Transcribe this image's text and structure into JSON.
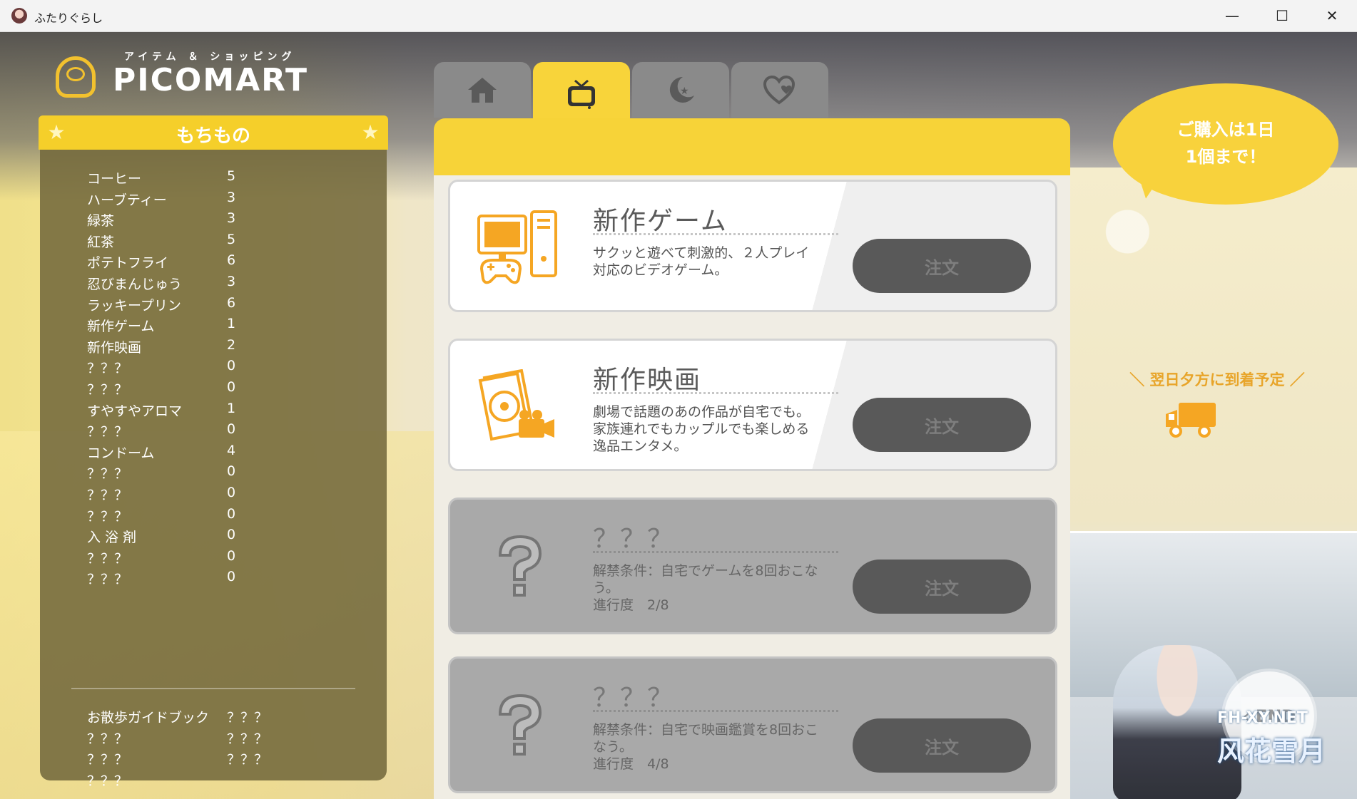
{
  "window": {
    "title": "ふたりぐらし",
    "controls": {
      "minimize": "—",
      "maximize": "☐",
      "close": "✕"
    }
  },
  "logo": {
    "subtitle": "アイテム ＆ ショッピング",
    "name": "PICOMART"
  },
  "inventory": {
    "title": "もちもの",
    "items": [
      {
        "name": "コーヒー",
        "count": "5"
      },
      {
        "name": "ハーブティー",
        "count": "3"
      },
      {
        "name": "緑茶",
        "count": "3"
      },
      {
        "name": "紅茶",
        "count": "5"
      },
      {
        "name": "ポテトフライ",
        "count": "6"
      },
      {
        "name": "忍びまんじゅう",
        "count": "3"
      },
      {
        "name": "ラッキープリン",
        "count": "6"
      },
      {
        "name": "新作ゲーム",
        "count": "1"
      },
      {
        "name": "新作映画",
        "count": "2"
      },
      {
        "name": "？？？",
        "count": "0"
      },
      {
        "name": "？？？",
        "count": "0"
      },
      {
        "name": "すやすやアロマ",
        "count": "1"
      },
      {
        "name": "？？？",
        "count": "0"
      },
      {
        "name": "コンドーム",
        "count": "4"
      },
      {
        "name": "？？？",
        "count": "0"
      },
      {
        "name": "？？？",
        "count": "0"
      },
      {
        "name": "？？？",
        "count": "0"
      },
      {
        "name": "入 浴 剤",
        "count": "0"
      },
      {
        "name": "？？？",
        "count": "0"
      },
      {
        "name": "？？？",
        "count": "0"
      }
    ],
    "guides": [
      {
        "a": "お散歩ガイドブック",
        "b": "？？？"
      },
      {
        "a": "？？？",
        "b": "？？？"
      },
      {
        "a": "？？？",
        "b": "？？？"
      },
      {
        "a": "？？？",
        "b": ""
      }
    ]
  },
  "tabs": [
    {
      "icon": "home-icon",
      "active": false
    },
    {
      "icon": "tv-icon",
      "active": true
    },
    {
      "icon": "moon-star-icon",
      "active": false
    },
    {
      "icon": "heart-icon",
      "active": false
    }
  ],
  "products": [
    {
      "title": "新作ゲーム",
      "desc": "サクッと遊べて刺激的、２人プレイ対応のビデオゲーム。",
      "button": "注文",
      "locked": false,
      "icon": "game-console-icon"
    },
    {
      "title": "新作映画",
      "desc": "劇場で話題のあの作品が自宅でも。家族連れでもカップルでも楽しめる逸品エンタメ。",
      "button": "注文",
      "locked": false,
      "icon": "movie-disc-icon"
    },
    {
      "title": "？？？",
      "desc": "解禁条件：自宅でゲームを8回おこなう。",
      "progress": "進行度　2/8",
      "button": "注文",
      "locked": true,
      "icon": "question-mark-icon"
    },
    {
      "title": "？？？",
      "desc": "解禁条件：自宅で映画鑑賞を8回おこなう。",
      "progress": "進行度　4/8",
      "button": "注文",
      "locked": true,
      "icon": "question-mark-icon"
    }
  ],
  "notice": {
    "bubble_line1": "ご購入は1日",
    "bubble_line2": "1個まで！",
    "arrival": "＼ 翌日夕方に到着予定 ／"
  },
  "end_button": "END",
  "watermark": {
    "site": "FH-XY.NET",
    "name": "风花雪月"
  },
  "colors": {
    "accent": "#f7d338",
    "panel": "#736a3c",
    "button": "#595959",
    "arrival": "#e8a52a",
    "icon_orange": "#f5a623"
  }
}
